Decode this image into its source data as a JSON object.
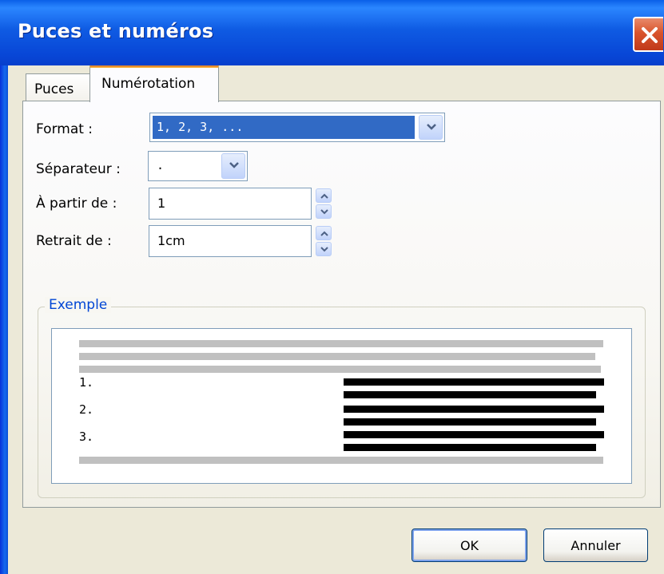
{
  "window": {
    "title": "Puces et numéros"
  },
  "tabs": [
    {
      "label": "Puces",
      "active": false
    },
    {
      "label": "Numérotation",
      "active": true
    }
  ],
  "form": {
    "format": {
      "label": "Format :",
      "value": "1, 2, 3, ..."
    },
    "separator": {
      "label": "Séparateur :",
      "value": "."
    },
    "start_at": {
      "label": "À partir de :",
      "value": "1"
    },
    "indent": {
      "label": "Retrait de :",
      "value": "1cm"
    }
  },
  "example": {
    "legend": "Exemple",
    "numbers": [
      "1.",
      "2.",
      "3."
    ]
  },
  "buttons": {
    "ok": "OK",
    "cancel": "Annuler"
  },
  "colors": {
    "title_bar": "#0846d6",
    "close_button": "#d9542c",
    "selection": "#316ac5",
    "legend_text": "#0046d5",
    "active_tab_accent": "#f5b53f"
  }
}
